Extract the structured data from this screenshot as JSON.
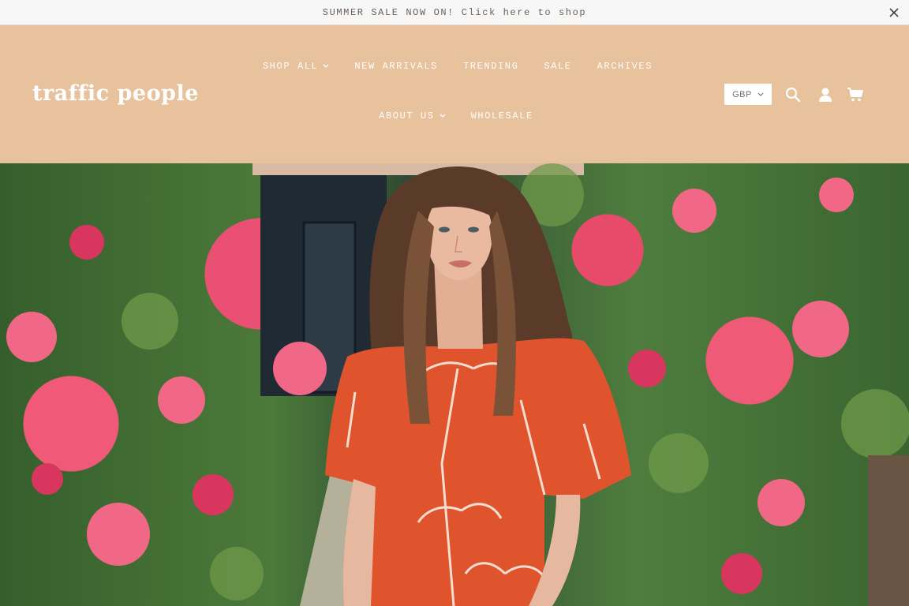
{
  "announcement": {
    "text": "SUMMER SALE NOW ON! Click here to shop",
    "close_icon": "close-icon"
  },
  "header": {
    "logo": "traffic people",
    "nav_row1": [
      {
        "label": "SHOP ALL",
        "has_dropdown": true
      },
      {
        "label": "NEW ARRIVALS",
        "has_dropdown": false
      },
      {
        "label": "TRENDING",
        "has_dropdown": false
      },
      {
        "label": "SALE",
        "has_dropdown": false
      },
      {
        "label": "ARCHIVES",
        "has_dropdown": false
      }
    ],
    "nav_row2": [
      {
        "label": "ABOUT US",
        "has_dropdown": true
      },
      {
        "label": "WHOLESALE",
        "has_dropdown": false
      }
    ],
    "currency": "GBP",
    "icons": [
      "search-icon",
      "account-icon",
      "cart-icon"
    ]
  },
  "colors": {
    "header_bg": "#e7c29c",
    "announcement_bg": "#f7f7f8",
    "announcement_text": "#6b5f57",
    "nav_text": "#ffffff"
  },
  "hero": {
    "image_subject": "model-in-orange-dress-among-roses"
  }
}
